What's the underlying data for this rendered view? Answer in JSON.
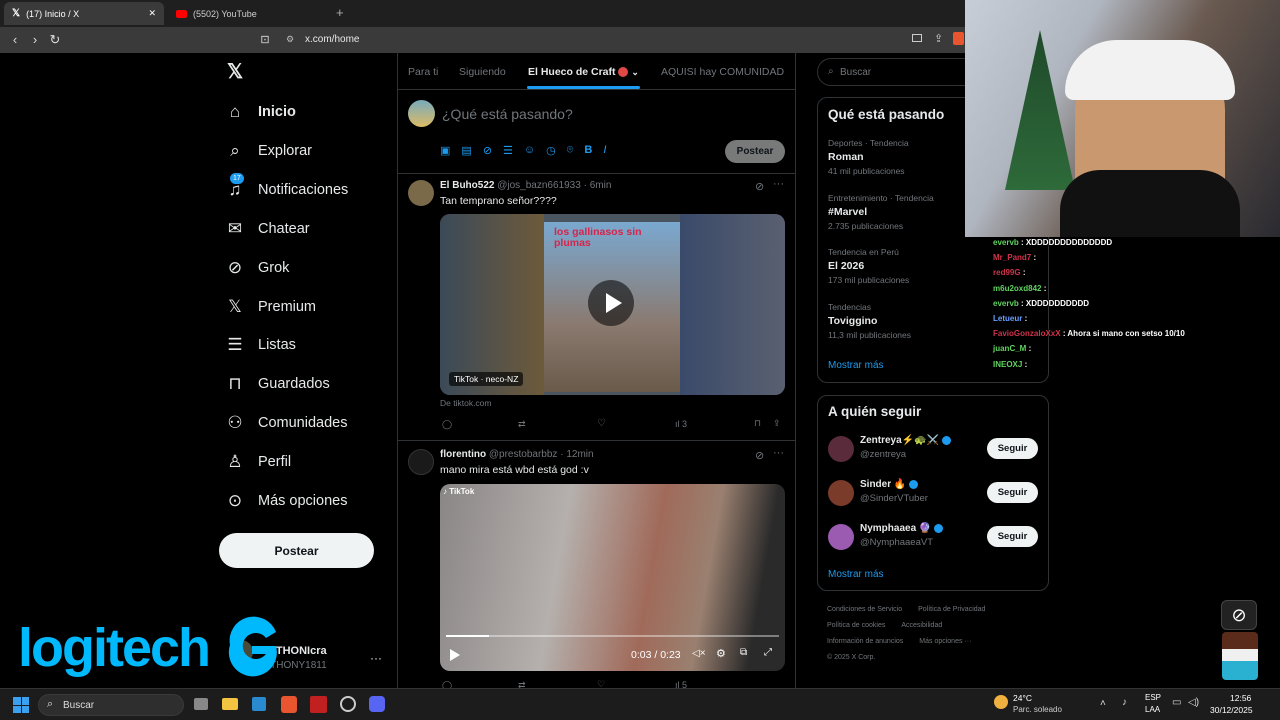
{
  "browser": {
    "tabs": [
      {
        "label": "(17) Inicio / X",
        "active": true
      },
      {
        "label": "(5502) YouTube",
        "active": false
      }
    ],
    "url": "x.com/home"
  },
  "nav": {
    "items": [
      {
        "label": "Inicio",
        "icon": "home-icon"
      },
      {
        "label": "Explorar",
        "icon": "search-icon"
      },
      {
        "label": "Notificaciones",
        "icon": "bell-icon",
        "badge": "17"
      },
      {
        "label": "Chatear",
        "icon": "mail-icon"
      },
      {
        "label": "Grok",
        "icon": "grok-icon"
      },
      {
        "label": "Premium",
        "icon": "x-icon"
      },
      {
        "label": "Listas",
        "icon": "list-icon"
      },
      {
        "label": "Guardados",
        "icon": "bookmark-icon"
      },
      {
        "label": "Comunidades",
        "icon": "people-icon"
      },
      {
        "label": "Perfil",
        "icon": "person-icon"
      },
      {
        "label": "Más opciones",
        "icon": "more-circle-icon"
      }
    ],
    "post_button": "Postear",
    "account": {
      "name": "ANTHONIcra",
      "handle": "@THONY1811"
    },
    "logo_text": "logitech"
  },
  "feed": {
    "tabs": [
      "Para ti",
      "Siguiendo",
      "El Hueco de Craft",
      "AQUISI hay COMUNIDAD"
    ],
    "compose_placeholder": "¿Qué está pasando?",
    "compose_button": "Postear",
    "posts": [
      {
        "author": "El Buho522",
        "handle": "@jos_bazn661933",
        "time": "6min",
        "text": "Tan temprano señor????",
        "media_caption": "los gallinasos sin plumas",
        "media_badge": "TikTok · neco-NZ",
        "source": "De tiktok.com",
        "views": "3"
      },
      {
        "author": "florentino",
        "handle": "@prestobarbbz",
        "time": "12min",
        "text": "mano mira está wbd está god :v",
        "video_time": "0:03 / 0:23",
        "video_progress": 0.13,
        "views": "5"
      }
    ]
  },
  "sidebar": {
    "search_placeholder": "Buscar",
    "trends_title": "Qué está pasando",
    "trends": [
      {
        "meta": "Deportes · Tendencia",
        "name": "Roman",
        "count": "41 mil publicaciones"
      },
      {
        "meta": "Entretenimiento · Tendencia",
        "name": "#Marvel",
        "count": "2.735 publicaciones"
      },
      {
        "meta": "Tendencia en Perú",
        "name": "El 2026",
        "count": "173 mil publicaciones"
      },
      {
        "meta": "Tendencias",
        "name": "Toviggino",
        "count": "11,3 mil publicaciones"
      }
    ],
    "show_more": "Mostrar más",
    "follow_title": "A quién seguir",
    "follow": [
      {
        "name": "Zentreya⚡🐢⚔️",
        "handle": "@zentreya",
        "button": "Seguir",
        "avatar_color": "#5a2b3a"
      },
      {
        "name": "Sinder 🔥",
        "handle": "@SinderVTuber",
        "button": "Seguir",
        "avatar_color": "#7a3b2a"
      },
      {
        "name": "Nymphaaea 🔮",
        "handle": "@NymphaaeaVT",
        "button": "Seguir",
        "avatar_color": "#9a5bb0"
      }
    ],
    "follow_more": "Mostrar más",
    "footer": [
      [
        "Condiciones de Servicio",
        "Política de Privacidad"
      ],
      [
        "Política de cookies",
        "Accesibilidad"
      ],
      [
        "Información de anuncios",
        "Más opciones ···"
      ],
      [
        "© 2025 X Corp."
      ]
    ]
  },
  "chat": [
    {
      "user": "evervb",
      "msg": ": XDDDDDDDDDDDDDD",
      "color": "#5fd35f"
    },
    {
      "user": "Mr_Pand7",
      "msg": ":",
      "color": "#d0334b"
    },
    {
      "user": "red99G",
      "msg": ":",
      "color": "#d0334b"
    },
    {
      "user": "m6u2oxd842",
      "msg": ":",
      "color": "#5fd35f"
    },
    {
      "user": "evervb",
      "msg": ": XDDDDDDDDDD",
      "color": "#5fd35f"
    },
    {
      "user": "Letueur",
      "msg": ":",
      "color": "#6aa0ff"
    },
    {
      "user": "FavioGonzaloXxX",
      "msg": ": Ahora si mano con setso 10/10",
      "color": "#d0334b"
    },
    {
      "user": "juanC_M",
      "msg": ":",
      "color": "#5fd35f"
    },
    {
      "user": "INEOXJ",
      "msg": ":",
      "color": "#5fd35f"
    }
  ],
  "taskbar": {
    "search": "Buscar",
    "weather_temp": "24°C",
    "weather_desc": "Parc. soleado",
    "lang": "ESP",
    "lang2": "LAA",
    "time": "12:56",
    "date": "30/12/2025"
  },
  "colors": {
    "accent": "#1d9bf0",
    "bg": "#000000",
    "border": "#2f3336"
  }
}
